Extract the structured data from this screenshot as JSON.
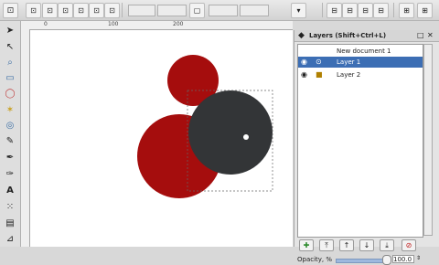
{
  "panel": {
    "title": "Layers (Shift+Ctrl+L)",
    "layers": [
      {
        "name": "New document 1",
        "selected": false,
        "visible": null,
        "locked": null
      },
      {
        "name": "Layer 1",
        "selected": true,
        "visible": true,
        "locked": false
      },
      {
        "name": "Layer 2",
        "selected": false,
        "visible": true,
        "locked": true
      }
    ],
    "buttons": [
      "add-layer-icon",
      "raise-to-top-icon",
      "raise-icon",
      "lower-icon",
      "lower-to-bottom-icon",
      "delete-layer-icon"
    ],
    "opacity_label": "Opacity, %",
    "opacity_value": "100.0"
  },
  "ruler": {
    "h_labels": [
      "0",
      "100",
      "200"
    ]
  },
  "tools": [
    "selector-icon",
    "node-icon",
    "zoom-icon",
    "rect-icon",
    "ellipse-icon",
    "star-icon",
    "spiral-icon",
    "pencil-icon",
    "calligraphy-icon",
    "text-icon",
    "gradient-icon",
    "dropper-icon"
  ],
  "colors": {
    "dark_red": "#a50d0d",
    "dark_gray": "#333537",
    "selection": "#3c6eb4"
  }
}
